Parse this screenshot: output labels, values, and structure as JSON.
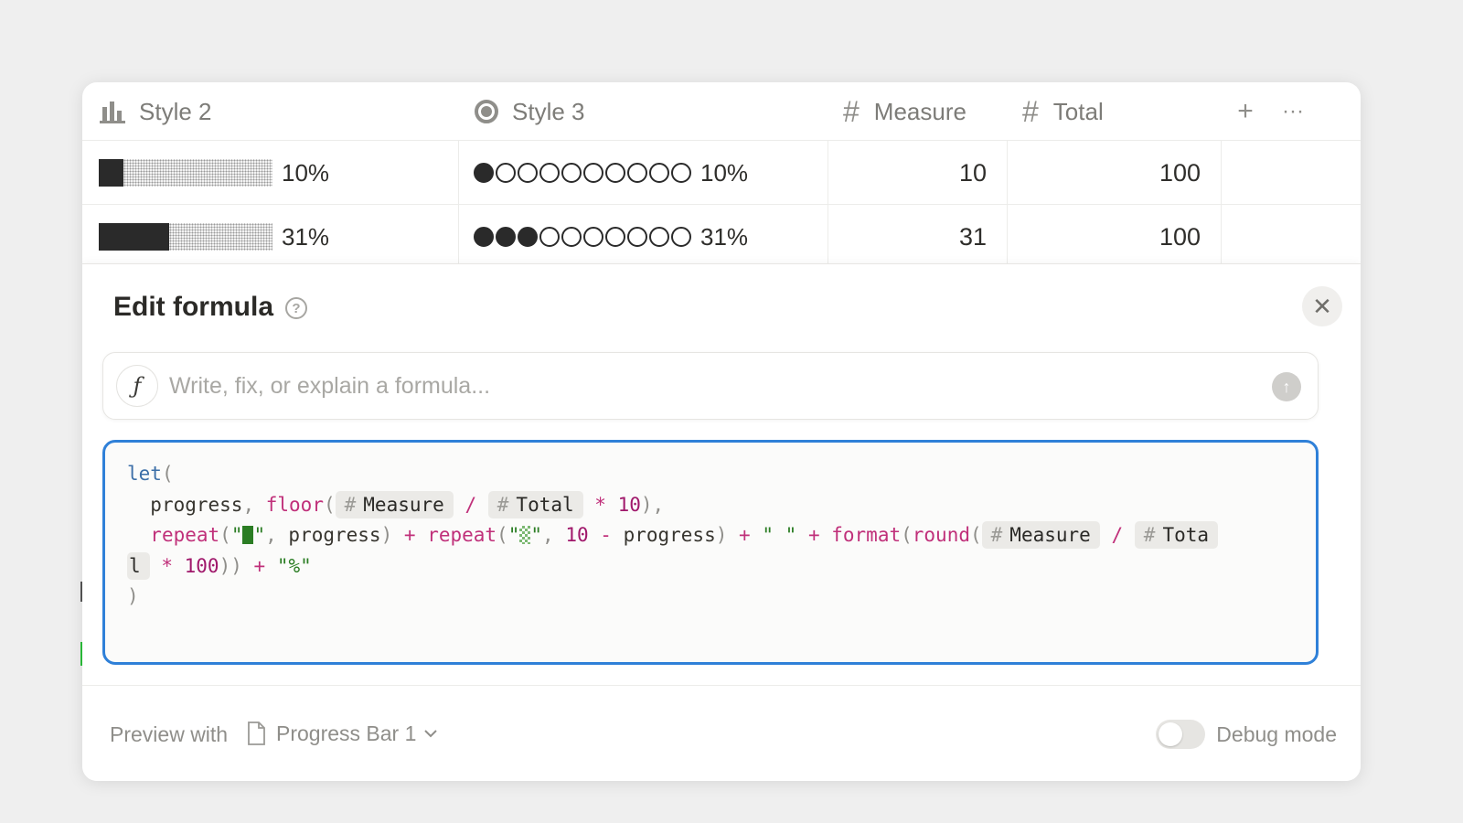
{
  "table": {
    "columns": [
      {
        "label": "Style 2",
        "icon": "bar-chart-icon"
      },
      {
        "label": "Style 3",
        "icon": "status-circle-icon"
      },
      {
        "label": "Measure",
        "icon": "hash-icon"
      },
      {
        "label": "Total",
        "icon": "hash-icon"
      }
    ],
    "add_column_label": "+",
    "more_label": "···",
    "rows": [
      {
        "style2_fraction": 0.1,
        "style2_text": "10%",
        "style3_filled": 1,
        "style3_total": 10,
        "style3_text": "10%",
        "measure": "10",
        "total": "100"
      },
      {
        "style2_fraction": 0.31,
        "style2_text": "31%",
        "style3_filled": 3,
        "style3_total": 10,
        "style3_text": "31%",
        "measure": "31",
        "total": "100"
      }
    ]
  },
  "panel": {
    "title": "Edit formula",
    "help_icon": "question-icon",
    "close_icon": "close-icon",
    "ai_placeholder": "Write, fix, or explain a formula...",
    "ai_icon": "formula-ai-icon",
    "send_icon": "arrow-up-icon",
    "code": {
      "let_kw": "let",
      "progress_var": "progress",
      "floor_fn": "floor",
      "measure_prop": "Measure",
      "total_prop": "Total",
      "total_prop_a": "Tota",
      "total_prop_b": "l",
      "ten": "10",
      "hundred": "100",
      "repeat_fn": "repeat",
      "format_fn": "format",
      "round_fn": "round",
      "space_str": "\" \"",
      "percent_str": "\"%\""
    },
    "footer": {
      "preview_label": "Preview with",
      "page_name": "Progress Bar 1",
      "debug_label": "Debug mode",
      "debug_on": false
    }
  },
  "colors": {
    "accent_focus": "#2f80d8",
    "keyword": "#3c6fa8",
    "function": "#c0307a",
    "string": "#2b7d24"
  }
}
